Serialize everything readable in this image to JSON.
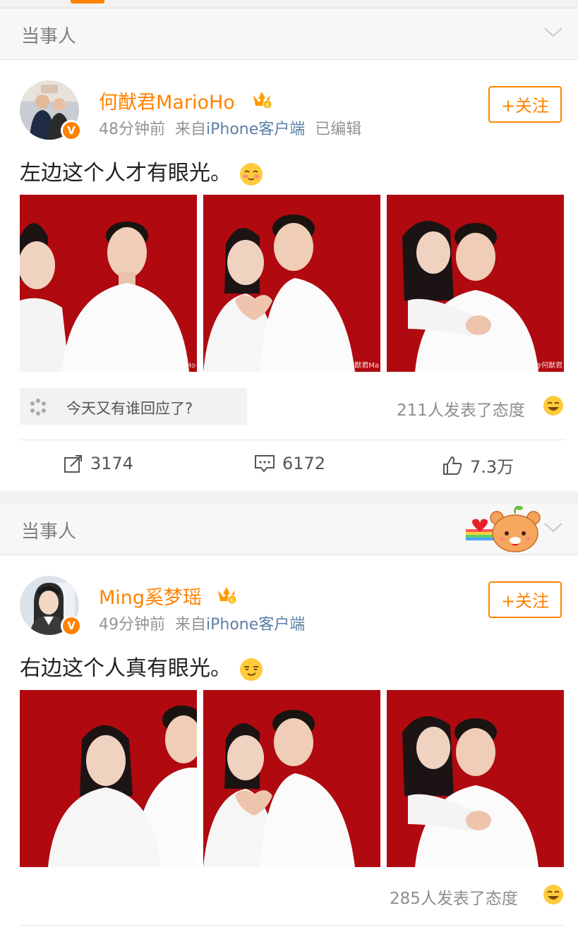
{
  "section_title": "当事人",
  "posts": [
    {
      "username": "何猷君MarioHo",
      "time": "48分钟前",
      "source_prefix": "来自",
      "source": "iPhone客户端",
      "edited": "已编辑",
      "follow_label": "+关注",
      "text": "左边这个人才有眼光。",
      "photos": [
        {
          "watermark": "@何猷君MarioHo"
        },
        {
          "watermark": "微博@何猷君Ma"
        },
        {
          "watermark": "微博@何猷君"
        }
      ],
      "reply_prompt": "今天又有谁回应了?",
      "attitude": "211人发表了态度",
      "reposts": "3174",
      "comments": "6172",
      "likes": "7.3万"
    },
    {
      "username": "Ming奚梦瑶",
      "time": "49分钟前",
      "source_prefix": "来自",
      "source": "iPhone客户端",
      "follow_label": "+关注",
      "text": "右边这个人真有眼光。",
      "photos": [
        {},
        {},
        {}
      ],
      "attitude": "285人发表了态度"
    }
  ],
  "colors": {
    "accent": "#ff8200",
    "photo_background": "#b0090f",
    "link": "#5d7fa6"
  }
}
